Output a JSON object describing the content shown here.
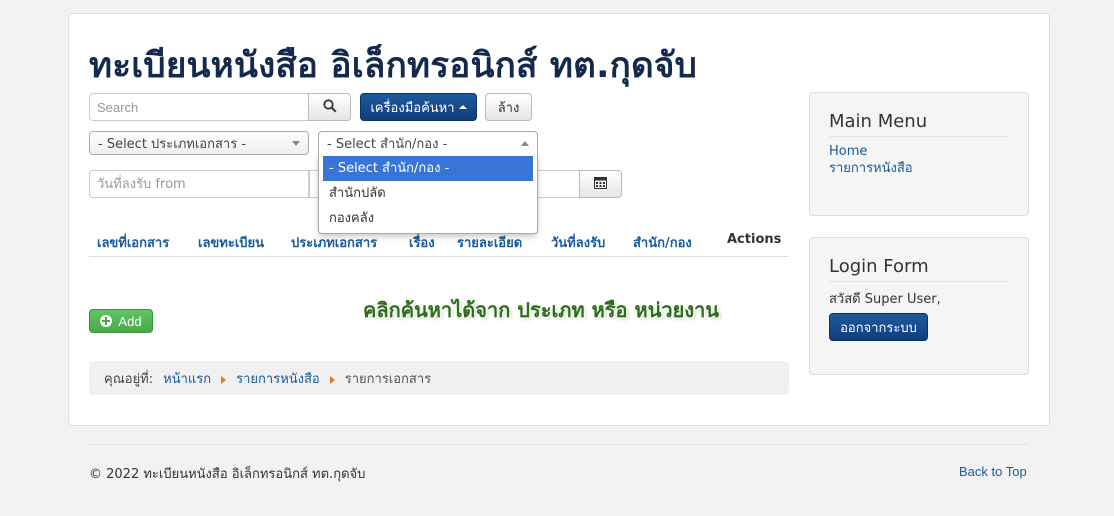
{
  "site": {
    "title": "ทะเบียนหนังสือ อิเล็กทรอนิกส์ ทต.กุดจับ"
  },
  "search": {
    "placeholder": "Search",
    "value": "",
    "search_icon": "search-icon",
    "tools_label": "เครื่องมือค้นหา",
    "clear_label": "ล้าง"
  },
  "filters": {
    "type_select": {
      "selected": "- Select ประเภทเอกสาร -"
    },
    "office_select": {
      "selected": "- Select สำนัก/กอง -",
      "options": [
        "- Select สำนัก/กอง -",
        "สำนักปลัด",
        "กองคลัง"
      ],
      "open": true
    },
    "date_from_placeholder": "วันที่ลงรับ from",
    "calendar_icon": "calendar-icon"
  },
  "table": {
    "columns": [
      "เลขที่เอกสาร",
      "เลขทะเบียน",
      "ประเภทเอกสาร",
      "เรื่อง",
      "รายละเอียด",
      "วันที่ลงรับ",
      "สำนัก/กอง",
      "Actions"
    ]
  },
  "actions": {
    "add_label": "Add"
  },
  "hint": "คลิกค้นหาได้จาก ประเภท หรือ หน่วยงาน",
  "breadcrumb": {
    "here_label": "คุณอยู่ที่:",
    "items": [
      "หน้าแรก",
      "รายการหนังสือ"
    ],
    "current": "รายการเอกสาร"
  },
  "main_menu": {
    "title": "Main Menu",
    "items": [
      "Home",
      "รายการหนังสือ"
    ]
  },
  "login_form": {
    "title": "Login Form",
    "greeting": "สวัสดี Super User,",
    "logout_label": "ออกจากระบบ"
  },
  "footer": {
    "copyright": "© 2022 ทะเบียนหนังสือ อิเล็กทรอนิกส์ ทต.กุดจับ",
    "back_to_top": "Back to Top"
  },
  "colors": {
    "title": "#13294d",
    "primary_button": "#103d7a",
    "link": "#1a5b9c",
    "add_button": "#4aa84a",
    "dropdown_highlight": "#3875d7",
    "hint_text": "#2f6d1e"
  }
}
